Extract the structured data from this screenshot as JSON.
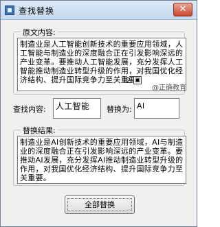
{
  "window": {
    "title": "查找替换",
    "close_glyph": "✕"
  },
  "original": {
    "legend": "原文内容:",
    "text": "制造业是人工智能创新技术的重要应用领域，人工智能与制造业的深度融合正在引发影响深远的产业变革。要推动人工智能发展，充分发挥人工智能推动制造业转型升级的作用，对我国优化经济结构、提升国际竞争力至关重要。",
    "page_mark": "2"
  },
  "watermark": "@正确教育",
  "find": {
    "label": "查找内容:",
    "value": "人工智能"
  },
  "replace": {
    "label": "替换为:",
    "value": "AI"
  },
  "result": {
    "legend": "替换结果:",
    "text": "制造业是AI创新技术的重要应用领域，AI与制造业的深度融合正在引发影响深远的产业变革。要推动AI发展，充分发挥AI推动制造业转型升级的作用，对我国优化经济结构、提升国际竞争力至关重要。"
  },
  "actions": {
    "replace_all_label": "全部替换"
  }
}
